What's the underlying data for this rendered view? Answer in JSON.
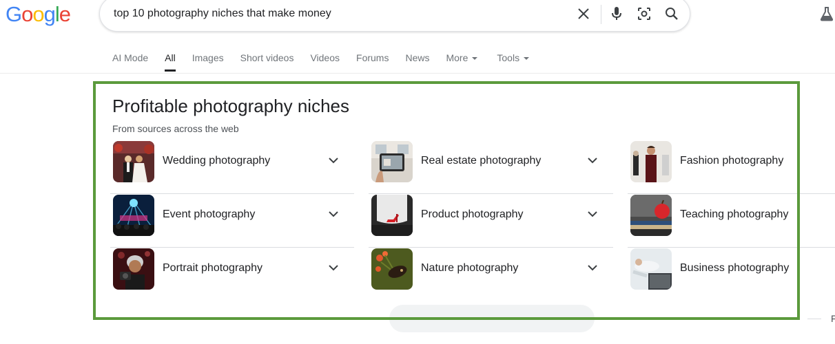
{
  "logo": {
    "text": "Google",
    "letters": [
      "G",
      "o",
      "o",
      "g",
      "l",
      "e"
    ],
    "colors": [
      "#4285f4",
      "#ea4335",
      "#fbbc05",
      "#4285f4",
      "#34a853",
      "#ea4335"
    ]
  },
  "search": {
    "query": "top 10 photography niches that make money"
  },
  "icons": {
    "clear": "close-icon",
    "voice": "microphone-icon",
    "lens": "camera-lens-icon",
    "search": "search-icon",
    "labs": "flask-icon"
  },
  "tabs": [
    {
      "label": "AI Mode",
      "active": false
    },
    {
      "label": "All",
      "active": true
    },
    {
      "label": "Images",
      "active": false
    },
    {
      "label": "Short videos",
      "active": false
    },
    {
      "label": "Videos",
      "active": false
    },
    {
      "label": "Forums",
      "active": false
    },
    {
      "label": "News",
      "active": false
    },
    {
      "label": "More",
      "active": false,
      "dropdown": true
    },
    {
      "label": "Tools",
      "active": false,
      "dropdown": true
    }
  ],
  "panel": {
    "title": "Profitable photography niches",
    "subtitle": "From sources across the web",
    "highlight_color": "#5b9a3c",
    "items": [
      {
        "label": "Wedding photography",
        "thumb": "wedding-photo"
      },
      {
        "label": "Real estate photography",
        "thumb": "real-estate-photo"
      },
      {
        "label": "Fashion photography",
        "thumb": "fashion-photo"
      },
      {
        "label": "Event photography",
        "thumb": "event-photo"
      },
      {
        "label": "Product photography",
        "thumb": "product-photo"
      },
      {
        "label": "Teaching photography",
        "thumb": "teaching-photo"
      },
      {
        "label": "Portrait photography",
        "thumb": "portrait-photo"
      },
      {
        "label": "Nature photography",
        "thumb": "nature-photo"
      },
      {
        "label": "Business photography",
        "thumb": "business-photo"
      }
    ]
  },
  "edge_text": "F"
}
